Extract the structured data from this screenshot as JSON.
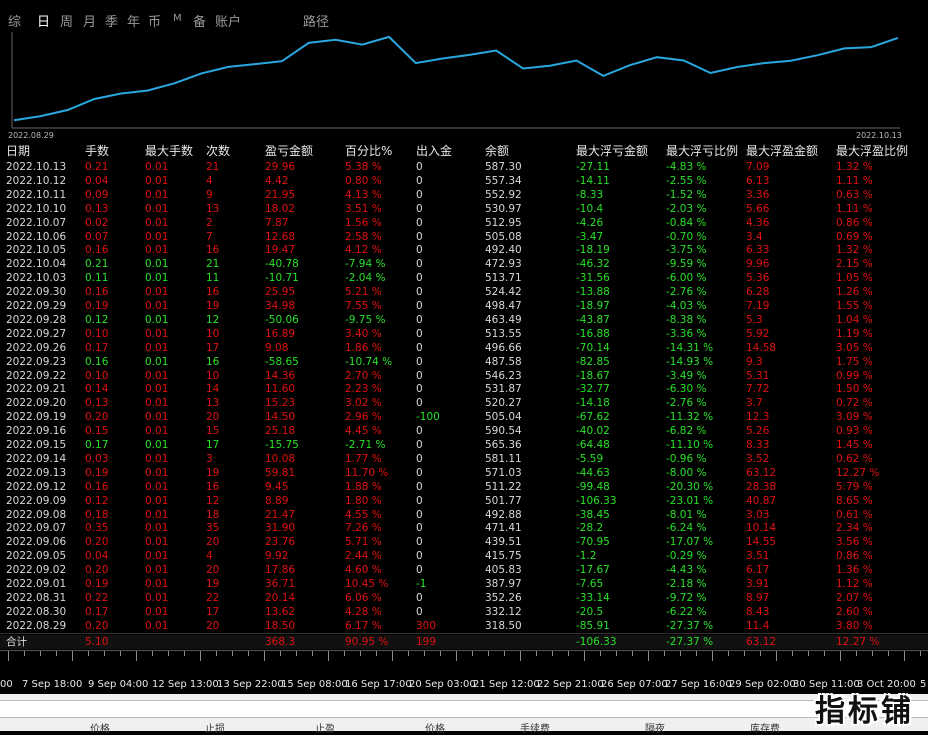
{
  "tabs": [
    "综",
    "日",
    "周",
    "月",
    "季",
    "年",
    "币",
    "M",
    "备",
    "账户",
    "路径"
  ],
  "active_tab": "日",
  "equity_chart": {
    "x_start_label": "2022.08.29",
    "x_end_label": "2022.10.13",
    "line_color": "#29a8e0",
    "series": [
      318.5,
      332.12,
      352.26,
      387.97,
      405.83,
      415.75,
      439.51,
      471.41,
      492.88,
      501.77,
      511.22,
      571.03,
      581.11,
      565.36,
      590.54,
      505.04,
      520.27,
      531.87,
      546.23,
      487.58,
      496.66,
      513.55,
      463.49,
      498.47,
      524.42,
      513.71,
      472.93,
      492.4,
      505.08,
      512.95,
      530.97,
      552.92,
      557.34,
      587.3
    ]
  },
  "table": {
    "headers": [
      "日期",
      "手数",
      "最大手数",
      "次数",
      "盈亏金额",
      "百分比%",
      "出入金",
      "余额",
      "最大浮亏金额",
      "最大浮亏比例",
      "最大浮盈金额",
      "最大浮盈比例"
    ],
    "rows": [
      [
        "2022.10.13",
        "0.21",
        "0.01",
        "21",
        "29.96",
        "5.38 %",
        "0",
        "587.30",
        "-27.11",
        "-4.83 %",
        "7.09",
        "1.32 %"
      ],
      [
        "2022.10.12",
        "0.04",
        "0.01",
        "4",
        "4.42",
        "0.80 %",
        "0",
        "557.34",
        "-14.11",
        "-2.55 %",
        "6.13",
        "1.11 %"
      ],
      [
        "2022.10.11",
        "0.09",
        "0.01",
        "9",
        "21.95",
        "4.13 %",
        "0",
        "552.92",
        "-8.33",
        "-1.52 %",
        "3.36",
        "0.63 %"
      ],
      [
        "2022.10.10",
        "0.13",
        "0.01",
        "13",
        "18.02",
        "3.51 %",
        "0",
        "530.97",
        "-10.4",
        "-2.03 %",
        "5.66",
        "1.11 %"
      ],
      [
        "2022.10.07",
        "0.02",
        "0.01",
        "2",
        "7.87",
        "1.56 %",
        "0",
        "512.95",
        "-4.26",
        "-0.84 %",
        "4.36",
        "0.86 %"
      ],
      [
        "2022.10.06",
        "0.07",
        "0.01",
        "7",
        "12.68",
        "2.58 %",
        "0",
        "505.08",
        "-3.47",
        "-0.70 %",
        "3.4",
        "0.69 %"
      ],
      [
        "2022.10.05",
        "0.16",
        "0.01",
        "16",
        "19.47",
        "4.12 %",
        "0",
        "492.40",
        "-18.19",
        "-3.75 %",
        "6.33",
        "1.32 %"
      ],
      [
        "2022.10.04",
        "0.21",
        "0.01",
        "21",
        "-40.78",
        "-7.94 %",
        "0",
        "472.93",
        "-46.32",
        "-9.59 %",
        "9.96",
        "2.15 %"
      ],
      [
        "2022.10.03",
        "0.11",
        "0.01",
        "11",
        "-10.71",
        "-2.04 %",
        "0",
        "513.71",
        "-31.56",
        "-6.00 %",
        "5.36",
        "1.05 %"
      ],
      [
        "2022.09.30",
        "0.16",
        "0.01",
        "16",
        "25.95",
        "5.21 %",
        "0",
        "524.42",
        "-13.88",
        "-2.76 %",
        "6.28",
        "1.26 %"
      ],
      [
        "2022.09.29",
        "0.19",
        "0.01",
        "19",
        "34.98",
        "7.55 %",
        "0",
        "498.47",
        "-18.97",
        "-4.03 %",
        "7.19",
        "1.55 %"
      ],
      [
        "2022.09.28",
        "0.12",
        "0.01",
        "12",
        "-50.06",
        "-9.75 %",
        "0",
        "463.49",
        "-43.87",
        "-8.38 %",
        "5.3",
        "1.04 %"
      ],
      [
        "2022.09.27",
        "0.10",
        "0.01",
        "10",
        "16.89",
        "3.40 %",
        "0",
        "513.55",
        "-16.88",
        "-3.36 %",
        "5.92",
        "1.19 %"
      ],
      [
        "2022.09.26",
        "0.17",
        "0.01",
        "17",
        "9.08",
        "1.86 %",
        "0",
        "496.66",
        "-70.14",
        "-14.31 %",
        "14.58",
        "3.05 %"
      ],
      [
        "2022.09.23",
        "0.16",
        "0.01",
        "16",
        "-58.65",
        "-10.74 %",
        "0",
        "487.58",
        "-82.85",
        "-14.93 %",
        "9.3",
        "1.75 %"
      ],
      [
        "2022.09.22",
        "0.10",
        "0.01",
        "10",
        "14.36",
        "2.70 %",
        "0",
        "546.23",
        "-18.67",
        "-3.49 %",
        "5.31",
        "0.99 %"
      ],
      [
        "2022.09.21",
        "0.14",
        "0.01",
        "14",
        "11.60",
        "2.23 %",
        "0",
        "531.87",
        "-32.77",
        "-6.30 %",
        "7.72",
        "1.50 %"
      ],
      [
        "2022.09.20",
        "0.13",
        "0.01",
        "13",
        "15.23",
        "3.02 %",
        "0",
        "520.27",
        "-14.18",
        "-2.76 %",
        "3.7",
        "0.72 %"
      ],
      [
        "2022.09.19",
        "0.20",
        "0.01",
        "20",
        "14.50",
        "2.96 %",
        "-100",
        "505.04",
        "-67.62",
        "-11.32 %",
        "12.3",
        "3.09 %"
      ],
      [
        "2022.09.16",
        "0.15",
        "0.01",
        "15",
        "25.18",
        "4.45 %",
        "0",
        "590.54",
        "-40.02",
        "-6.82 %",
        "5.26",
        "0.93 %"
      ],
      [
        "2022.09.15",
        "0.17",
        "0.01",
        "17",
        "-15.75",
        "-2.71 %",
        "0",
        "565.36",
        "-64.48",
        "-11.10 %",
        "8.33",
        "1.45 %"
      ],
      [
        "2022.09.14",
        "0.03",
        "0.01",
        "3",
        "10.08",
        "1.77 %",
        "0",
        "581.11",
        "-5.59",
        "-0.96 %",
        "3.52",
        "0.62 %"
      ],
      [
        "2022.09.13",
        "0.19",
        "0.01",
        "19",
        "59.81",
        "11.70 %",
        "0",
        "571.03",
        "-44.63",
        "-8.00 %",
        "63.12",
        "12.27 %"
      ],
      [
        "2022.09.12",
        "0.16",
        "0.01",
        "16",
        "9.45",
        "1.88 %",
        "0",
        "511.22",
        "-99.48",
        "-20.30 %",
        "28.38",
        "5.79 %"
      ],
      [
        "2022.09.09",
        "0.12",
        "0.01",
        "12",
        "8.89",
        "1.80 %",
        "0",
        "501.77",
        "-106.33",
        "-23.01 %",
        "40.87",
        "8.65 %"
      ],
      [
        "2022.09.08",
        "0.18",
        "0.01",
        "18",
        "21.47",
        "4.55 %",
        "0",
        "492.88",
        "-38.45",
        "-8.01 %",
        "3.03",
        "0.61 %"
      ],
      [
        "2022.09.07",
        "0.35",
        "0.01",
        "35",
        "31.90",
        "7.26 %",
        "0",
        "471.41",
        "-28.2",
        "-6.24 %",
        "10.14",
        "2.34 %"
      ],
      [
        "2022.09.06",
        "0.20",
        "0.01",
        "20",
        "23.76",
        "5.71 %",
        "0",
        "439.51",
        "-70.95",
        "-17.07 %",
        "14.55",
        "3.56 %"
      ],
      [
        "2022.09.05",
        "0.04",
        "0.01",
        "4",
        "9.92",
        "2.44 %",
        "0",
        "415.75",
        "-1.2",
        "-0.29 %",
        "3.51",
        "0.86 %"
      ],
      [
        "2022.09.02",
        "0.20",
        "0.01",
        "20",
        "17.86",
        "4.60 %",
        "0",
        "405.83",
        "-17.67",
        "-4.43 %",
        "6.17",
        "1.36 %"
      ],
      [
        "2022.09.01",
        "0.19",
        "0.01",
        "19",
        "36.71",
        "10.45 %",
        "-1",
        "387.97",
        "-7.65",
        "-2.18 %",
        "3.91",
        "1.12 %"
      ],
      [
        "2022.08.31",
        "0.22",
        "0.01",
        "22",
        "20.14",
        "6.06 %",
        "0",
        "352.26",
        "-33.14",
        "-9.72 %",
        "8.97",
        "2.07 %"
      ],
      [
        "2022.08.30",
        "0.17",
        "0.01",
        "17",
        "13.62",
        "4.28 %",
        "0",
        "332.12",
        "-20.5",
        "-6.22 %",
        "8.43",
        "2.60 %"
      ],
      [
        "2022.08.29",
        "0.20",
        "0.01",
        "20",
        "18.50",
        "6.17 %",
        "300",
        "318.50",
        "-85.91",
        "-27.37 %",
        "11.4",
        "3.80 %"
      ]
    ],
    "total": [
      "合计",
      "5.10",
      "",
      "",
      "368.3",
      "90.95 %",
      "199",
      "",
      "-106.33",
      "-27.37 %",
      "63.12",
      "12.27 %"
    ]
  },
  "time_axis": {
    "labels": [
      "00",
      "7 Sep 18:00",
      "9 Sep 04:00",
      "12 Sep 13:00",
      "13 Sep 22:00",
      "15 Sep 08:00",
      "16 Sep 17:00",
      "20 Sep 03:00",
      "21 Sep 12:00",
      "22 Sep 21:00",
      "26 Sep 07:00",
      "27 Sep 16:00",
      "29 Sep 02:00",
      "30 Sep 11:00",
      "3 Oct 20:00",
      "5"
    ]
  },
  "bottom_panel": {
    "columns": [
      "价格",
      "止损",
      "止盈",
      "价格",
      "手续费",
      "隔夜",
      "库存费"
    ]
  },
  "watermark": "指标铺"
}
